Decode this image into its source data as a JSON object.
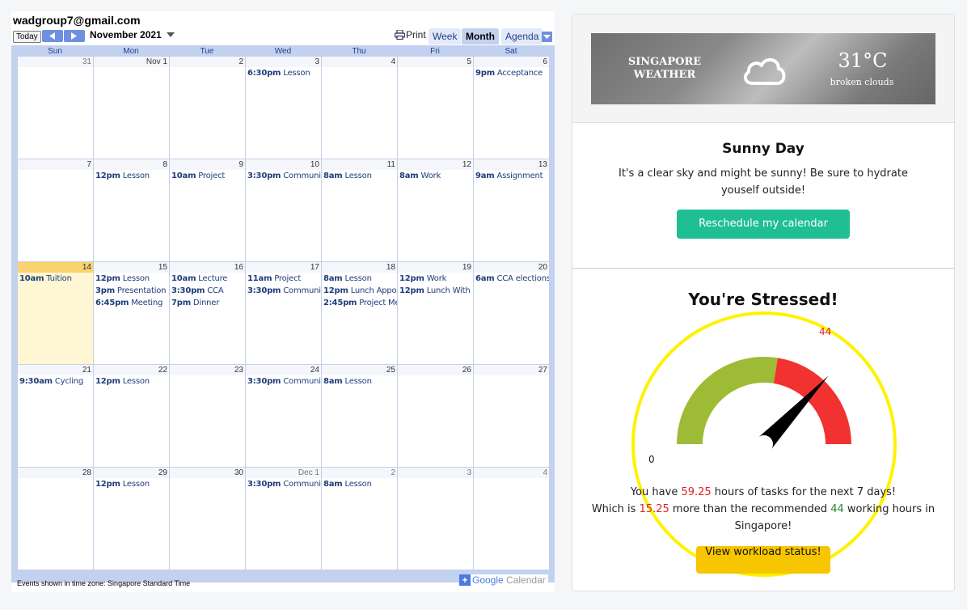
{
  "calendar": {
    "account": "wadgroup7@gmail.com",
    "today_label": "Today",
    "month_title": "November 2021",
    "print_label": "Print",
    "views": [
      "Week",
      "Month",
      "Agenda"
    ],
    "weekdays": [
      "Sun",
      "Mon",
      "Tue",
      "Wed",
      "Thu",
      "Fri",
      "Sat"
    ],
    "weeks": [
      [
        {
          "label": "31",
          "muted": true,
          "events": []
        },
        {
          "label": "Nov 1",
          "muted": false,
          "events": []
        },
        {
          "label": "2",
          "muted": false,
          "events": []
        },
        {
          "label": "3",
          "muted": false,
          "events": [
            {
              "time": "6:30pm",
              "title": "Lesson"
            }
          ]
        },
        {
          "label": "4",
          "muted": false,
          "events": []
        },
        {
          "label": "5",
          "muted": false,
          "events": []
        },
        {
          "label": "6",
          "muted": false,
          "events": [
            {
              "time": "9pm",
              "title": "Acceptance"
            }
          ]
        }
      ],
      [
        {
          "label": "7",
          "muted": false,
          "events": []
        },
        {
          "label": "8",
          "muted": false,
          "events": [
            {
              "time": "12pm",
              "title": "Lesson"
            }
          ]
        },
        {
          "label": "9",
          "muted": false,
          "events": [
            {
              "time": "10am",
              "title": "Project"
            }
          ]
        },
        {
          "label": "10",
          "muted": false,
          "events": [
            {
              "time": "3:30pm",
              "title": "Community"
            }
          ]
        },
        {
          "label": "11",
          "muted": false,
          "events": [
            {
              "time": "8am",
              "title": "Lesson"
            }
          ]
        },
        {
          "label": "12",
          "muted": false,
          "events": [
            {
              "time": "8am",
              "title": "Work"
            }
          ]
        },
        {
          "label": "13",
          "muted": false,
          "events": [
            {
              "time": "9am",
              "title": "Assignment"
            }
          ]
        }
      ],
      [
        {
          "label": "14",
          "muted": false,
          "today": true,
          "events": [
            {
              "time": "10am",
              "title": "Tuition"
            }
          ]
        },
        {
          "label": "15",
          "muted": false,
          "events": [
            {
              "time": "12pm",
              "title": "Lesson"
            },
            {
              "time": "3pm",
              "title": "Presentation"
            },
            {
              "time": "6:45pm",
              "title": "Meeting"
            }
          ]
        },
        {
          "label": "16",
          "muted": false,
          "events": [
            {
              "time": "10am",
              "title": "Lecture"
            },
            {
              "time": "3:30pm",
              "title": "CCA"
            },
            {
              "time": "7pm",
              "title": "Dinner"
            }
          ]
        },
        {
          "label": "17",
          "muted": false,
          "events": [
            {
              "time": "11am",
              "title": "Project"
            },
            {
              "time": "3:30pm",
              "title": "Community"
            }
          ]
        },
        {
          "label": "18",
          "muted": false,
          "events": [
            {
              "time": "8am",
              "title": "Lesson"
            },
            {
              "time": "12pm",
              "title": "Lunch Appoir"
            },
            {
              "time": "2:45pm",
              "title": "Project Mee"
            }
          ]
        },
        {
          "label": "19",
          "muted": false,
          "events": [
            {
              "time": "12pm",
              "title": "Work"
            },
            {
              "time": "12pm",
              "title": "Lunch With S"
            }
          ]
        },
        {
          "label": "20",
          "muted": false,
          "events": [
            {
              "time": "6am",
              "title": "CCA elections"
            }
          ]
        }
      ],
      [
        {
          "label": "21",
          "muted": false,
          "events": [
            {
              "time": "9:30am",
              "title": "Cycling"
            }
          ]
        },
        {
          "label": "22",
          "muted": false,
          "events": [
            {
              "time": "12pm",
              "title": "Lesson"
            }
          ]
        },
        {
          "label": "23",
          "muted": false,
          "events": []
        },
        {
          "label": "24",
          "muted": false,
          "events": [
            {
              "time": "3:30pm",
              "title": "Community"
            }
          ]
        },
        {
          "label": "25",
          "muted": false,
          "events": [
            {
              "time": "8am",
              "title": "Lesson"
            }
          ]
        },
        {
          "label": "26",
          "muted": false,
          "events": []
        },
        {
          "label": "27",
          "muted": false,
          "events": []
        }
      ],
      [
        {
          "label": "28",
          "muted": false,
          "events": []
        },
        {
          "label": "29",
          "muted": false,
          "events": [
            {
              "time": "12pm",
              "title": "Lesson"
            }
          ]
        },
        {
          "label": "30",
          "muted": false,
          "events": []
        },
        {
          "label": "Dec 1",
          "muted": true,
          "events": [
            {
              "time": "3:30pm",
              "title": "Community"
            }
          ]
        },
        {
          "label": "2",
          "muted": true,
          "events": [
            {
              "time": "8am",
              "title": "Lesson"
            }
          ]
        },
        {
          "label": "3",
          "muted": true,
          "events": []
        },
        {
          "label": "4",
          "muted": true,
          "events": []
        }
      ]
    ],
    "timezone_note": "Events shown in time zone: Singapore Standard Time",
    "branding": {
      "google": "Google",
      "calendar": "Calendar"
    }
  },
  "weather": {
    "city": "SINGAPORE",
    "label": "WEATHER",
    "temperature": "31°C",
    "description": "broken clouds",
    "icon": "cloud-icon"
  },
  "sunny": {
    "title": "Sunny Day",
    "message": "It's a clear sky and might be sunny! Be sure to hydrate youself outside!",
    "button": "Reschedule my calendar"
  },
  "stress": {
    "title": "You're Stressed!",
    "gauge": {
      "min_label": "0",
      "max_label": "44",
      "value": 59.25,
      "threshold": 44,
      "colors": {
        "ok": "#9dbb35",
        "over": "#f23131"
      }
    },
    "line1": {
      "prefix": "You have ",
      "hours": "59.25",
      "suffix": " hours of tasks for the next 7 days!"
    },
    "line2": {
      "prefix": "Which is ",
      "extra": "15.25",
      "middle": " more than the recommended ",
      "recommended": "44",
      "suffix": " working hours in Singapore!"
    },
    "button": "View workload status!"
  },
  "colors": {
    "accent_teal": "#1fbe95",
    "accent_yellow": "#f7c600",
    "highlight_ring": "#fff200"
  }
}
